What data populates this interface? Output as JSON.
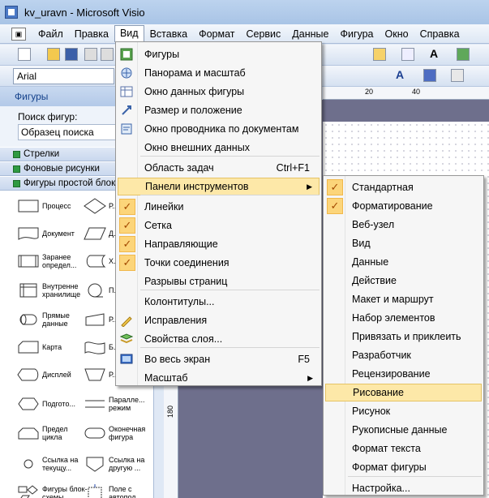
{
  "window": {
    "title": "kv_uravn - Microsoft Visio"
  },
  "menubar": {
    "items": [
      "Файл",
      "Правка",
      "Вид",
      "Вставка",
      "Формат",
      "Сервис",
      "Данные",
      "Фигура",
      "Окно",
      "Справка"
    ]
  },
  "toolbar": {
    "font": "Arial"
  },
  "shapes_panel": {
    "title": "Фигуры",
    "search_label": "Поиск фигур:",
    "search_value": "Образец поиска",
    "stencils": [
      "Стрелки",
      "Фоновые рисунки",
      "Фигуры простой блок-..."
    ],
    "shapes": [
      {
        "label": "Процесс",
        "icon": "process-shape-icon"
      },
      {
        "label": "Р...",
        "icon": "decision-shape-icon"
      },
      {
        "label": "Документ",
        "icon": "document-shape-icon"
      },
      {
        "label": "Д...",
        "icon": "data-shape-icon"
      },
      {
        "label": "Заранее определ...",
        "icon": "predefined-process-icon"
      },
      {
        "label": "Х... д...",
        "icon": "stored-data-icon"
      },
      {
        "label": "Внутренне хранилище",
        "icon": "internal-storage-icon"
      },
      {
        "label": "П... п...",
        "icon": "sequential-data-icon"
      },
      {
        "label": "Прямые данные",
        "icon": "direct-data-icon"
      },
      {
        "label": "Р... в...",
        "icon": "manual-input-icon"
      },
      {
        "label": "Карта",
        "icon": "card-shape-icon"
      },
      {
        "label": "Б... л...",
        "icon": "paper-tape-icon"
      },
      {
        "label": "Дисплей",
        "icon": "display-shape-icon"
      },
      {
        "label": "Р... о...",
        "icon": "manual-operation-icon"
      },
      {
        "label": "Подгото...",
        "icon": "preparation-shape-icon"
      },
      {
        "label": "Паралле... режим",
        "icon": "parallel-mode-icon"
      },
      {
        "label": "Предел цикла",
        "icon": "loop-limit-icon"
      },
      {
        "label": "Оконечная фигура",
        "icon": "terminator-shape-icon"
      },
      {
        "label": "Ссылка на текущу...",
        "icon": "on-page-reference-icon"
      },
      {
        "label": "Ссылка на другую ...",
        "icon": "off-page-reference-icon"
      },
      {
        "label": "Фигуры блок-схемы",
        "icon": "flowchart-shapes-icon"
      },
      {
        "label": "Поле с автопод...",
        "icon": "auto-height-box-icon"
      }
    ]
  },
  "ruler": {
    "h_labels": [
      "20",
      "40"
    ],
    "v_label": "180"
  },
  "view_menu": {
    "items": [
      {
        "label": "Фигуры",
        "icon": "shapes-icon"
      },
      {
        "label": "Панорама и масштаб",
        "icon": "pan-zoom-icon"
      },
      {
        "label": "Окно данных фигуры",
        "icon": "shape-data-icon"
      },
      {
        "label": "Размер и положение",
        "icon": "size-position-icon"
      },
      {
        "label": "Окно проводника по документам",
        "icon": "document-explorer-icon"
      },
      {
        "label": "Окно внешних данных",
        "icon": ""
      },
      {
        "label": "Область задач",
        "shortcut": "Ctrl+F1"
      },
      {
        "label": "Панели инструментов",
        "submenu": true
      },
      {
        "label": "Линейки",
        "checked": true
      },
      {
        "label": "Сетка",
        "checked": true
      },
      {
        "label": "Направляющие",
        "checked": true
      },
      {
        "label": "Точки соединения",
        "checked": true
      },
      {
        "label": "Разрывы страниц"
      },
      {
        "label": "Колонтитулы..."
      },
      {
        "label": "Исправления",
        "icon": "track-changes-icon"
      },
      {
        "label": "Свойства слоя...",
        "icon": "layer-properties-icon"
      },
      {
        "label": "Во весь экран",
        "icon": "full-screen-icon",
        "shortcut": "F5"
      },
      {
        "label": "Масштаб",
        "submenu": true
      }
    ]
  },
  "toolbars_submenu": {
    "items": [
      {
        "label": "Стандартная",
        "checked": true
      },
      {
        "label": "Форматирование",
        "checked": true
      },
      {
        "label": "Веб-узел"
      },
      {
        "label": "Вид"
      },
      {
        "label": "Данные"
      },
      {
        "label": "Действие"
      },
      {
        "label": "Макет и маршрут"
      },
      {
        "label": "Набор элементов"
      },
      {
        "label": "Привязать и приклеить"
      },
      {
        "label": "Разработчик"
      },
      {
        "label": "Рецензирование"
      },
      {
        "label": "Рисование"
      },
      {
        "label": "Рисунок"
      },
      {
        "label": "Рукописные данные"
      },
      {
        "label": "Формат текста"
      },
      {
        "label": "Формат фигуры"
      },
      {
        "label": "Настройка..."
      }
    ]
  },
  "colors": {
    "accent": "#fde8a8",
    "check": "#fcd57a",
    "canvas": "#6e6f8c"
  }
}
